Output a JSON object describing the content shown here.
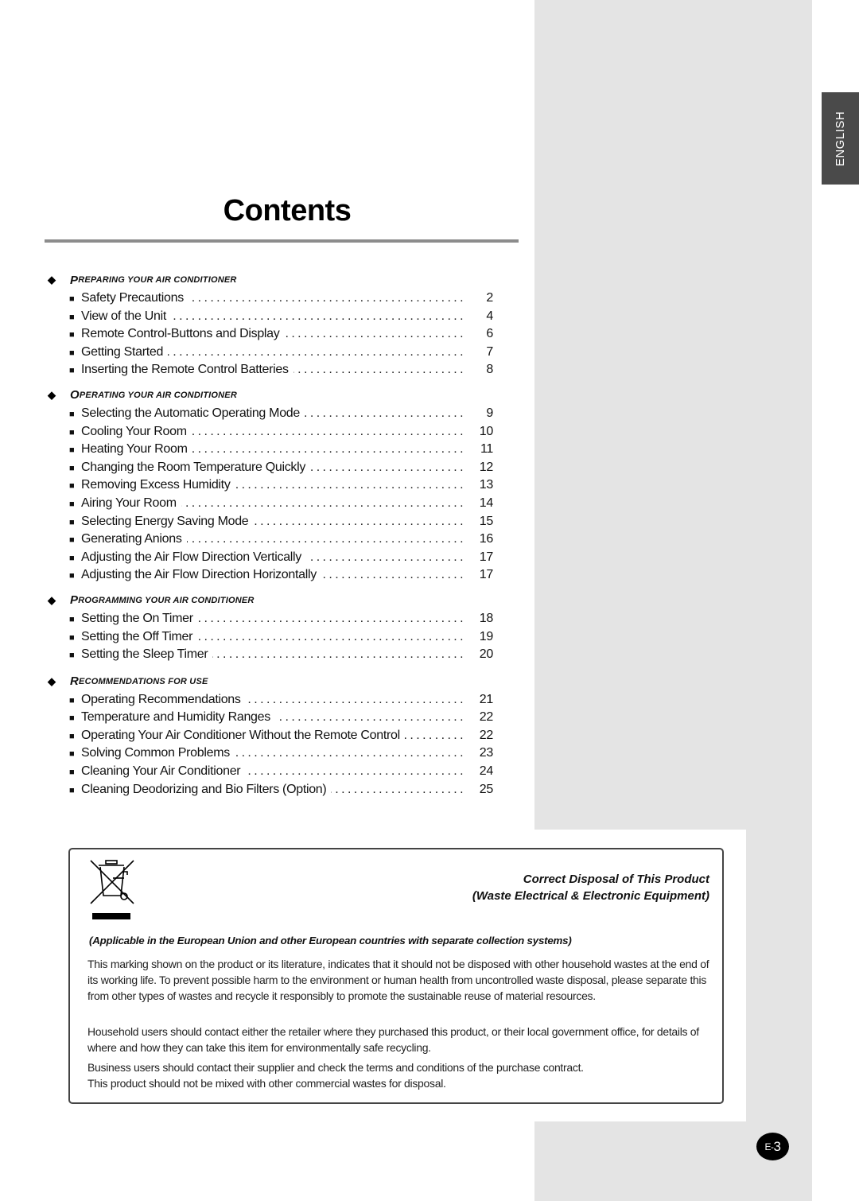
{
  "side_tab": {
    "language": "ENGLISH"
  },
  "title": "Contents",
  "sections": [
    {
      "first": "P",
      "rest": "REPARING YOUR AIR CONDITIONER",
      "entries": [
        {
          "label": "Safety Precautions",
          "page": "2"
        },
        {
          "label": "View of the Unit",
          "page": "4"
        },
        {
          "label": "Remote Control-Buttons and Display",
          "page": "6"
        },
        {
          "label": "Getting Started",
          "page": "7"
        },
        {
          "label": "Inserting the Remote Control Batteries",
          "page": "8"
        }
      ]
    },
    {
      "first": "O",
      "rest": "PERATING YOUR AIR CONDITIONER",
      "entries": [
        {
          "label": "Selecting the Automatic Operating Mode",
          "page": "9"
        },
        {
          "label": "Cooling Your Room",
          "page": "10"
        },
        {
          "label": "Heating Your Room",
          "page": "11"
        },
        {
          "label": "Changing the Room Temperature Quickly",
          "page": "12"
        },
        {
          "label": "Removing Excess Humidity",
          "page": "13"
        },
        {
          "label": "Airing Your Room",
          "page": "14"
        },
        {
          "label": "Selecting Energy Saving Mode",
          "page": "15"
        },
        {
          "label": "Generating Anions",
          "page": "16"
        },
        {
          "label": "Adjusting the Air Flow Direction Vertically",
          "page": "17"
        },
        {
          "label": "Adjusting the Air Flow Direction Horizontally",
          "page": "17"
        }
      ]
    },
    {
      "first": "P",
      "rest": "ROGRAMMING YOUR AIR CONDITIONER",
      "entries": [
        {
          "label": "Setting the On Timer",
          "page": "18"
        },
        {
          "label": "Setting the Off Timer",
          "page": "19"
        },
        {
          "label": "Setting the Sleep Timer",
          "page": "20"
        }
      ]
    },
    {
      "first": "R",
      "rest": "ECOMMENDATIONS FOR USE",
      "entries": [
        {
          "label": "Operating Recommendations",
          "page": "21"
        },
        {
          "label": "Temperature and Humidity Ranges",
          "page": "22"
        },
        {
          "label": "Operating Your Air Conditioner Without the Remote Control",
          "page": "22"
        },
        {
          "label": "Solving Common Problems",
          "page": "23"
        },
        {
          "label": "Cleaning Your Air Conditioner",
          "page": "24"
        },
        {
          "label": "Cleaning Deodorizing and Bio Filters (Option)",
          "page": "25"
        }
      ]
    }
  ],
  "disposal": {
    "icon": "crossed-out-wheelie-bin-icon",
    "title_line1": "Correct Disposal of This Product",
    "title_line2": "(Waste Electrical & Electronic Equipment)",
    "applicable": "(Applicable in the European Union and other European countries with separate collection systems)",
    "paragraph1": "This marking shown on the product or its literature, indicates that it should not be disposed with other household wastes at the end of its working life. To prevent possible harm to the environment or human health from uncontrolled waste disposal, please separate this from other types of wastes and recycle it responsibly to promote the sustainable reuse of material resources.",
    "paragraph2": "Household users should contact either the retailer where they purchased this product, or their local government office, for details of where and how they can take this item for environmentally safe recycling.",
    "paragraph3_line1": "Business users should contact their supplier and check the terms and conditions of the purchase contract.",
    "paragraph3_line2": "This product should not be mixed with other commercial wastes for disposal."
  },
  "page_number": {
    "prefix": "E-",
    "number": "3"
  }
}
